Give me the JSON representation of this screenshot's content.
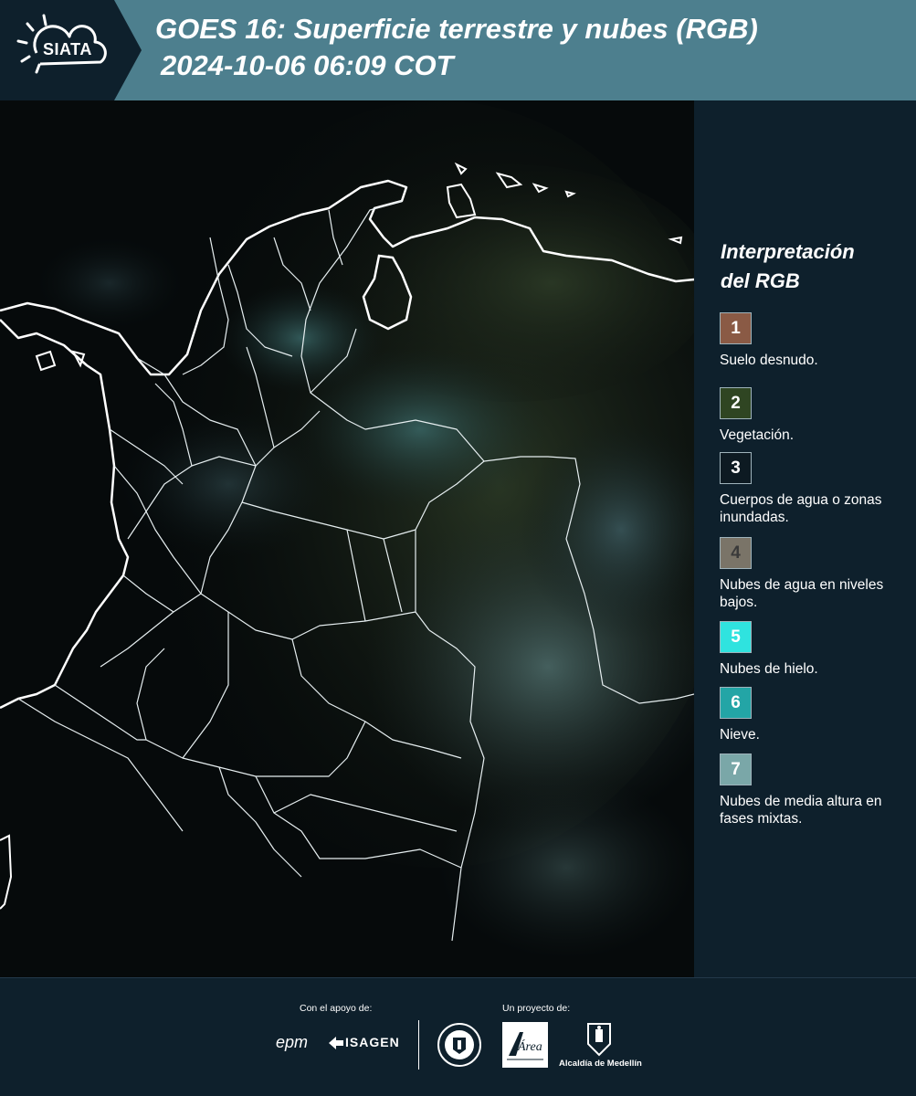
{
  "header": {
    "logo_text": "SIATA",
    "title_line1": "GOES 16: Superficie terrestre y nubes (RGB)",
    "title_line2": "2024-10-06 06:09 COT"
  },
  "legend": {
    "title_line1": "Interpretación",
    "title_line2": "del RGB",
    "items": [
      {
        "number": "1",
        "color": "#8a5a45",
        "label": "Suelo desnudo."
      },
      {
        "number": "2",
        "color": "#2f4522",
        "label": "Vegetación."
      },
      {
        "number": "3",
        "color": "#0d1a22",
        "label": "Cuerpos de agua o zonas inundadas."
      },
      {
        "number": "4",
        "color": "#7a7468",
        "label": "Nubes de agua en niveles bajos."
      },
      {
        "number": "5",
        "color": "#2fe3df",
        "label": "Nubes de hielo."
      },
      {
        "number": "6",
        "color": "#23a5a6",
        "label": "Nieve."
      },
      {
        "number": "7",
        "color": "#7aa7a8",
        "label": "Nubes de media altura en fases mixtas."
      }
    ]
  },
  "footer": {
    "support_label": "Con el apoyo de:",
    "project_label": "Un proyecto de:",
    "epm": "epm",
    "isagen": "ISAGEN",
    "area_metropolitana": "Área",
    "alcaldia": "Alcaldía de Medellín"
  },
  "colors": {
    "header_bg": "#4d7f8e",
    "panel_bg": "#0e202c",
    "border_line": "#ffffff"
  }
}
